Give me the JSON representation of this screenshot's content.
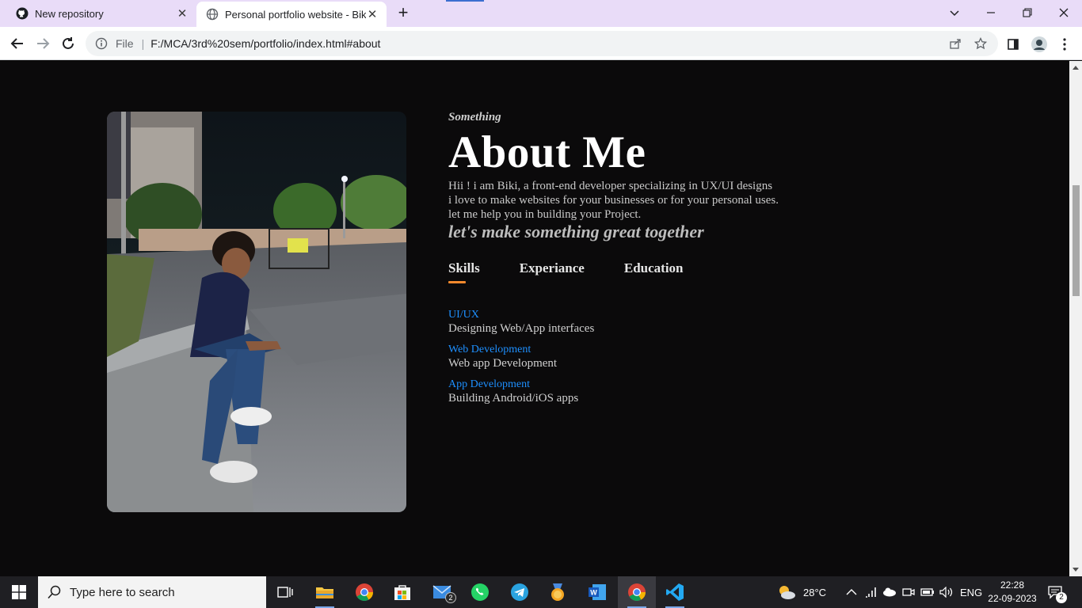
{
  "browser": {
    "tabs": [
      {
        "title": "New repository",
        "icon": "github-icon"
      },
      {
        "title": "Personal portfolio website - Biki",
        "icon": "globe-icon"
      }
    ],
    "address": {
      "scheme_label": "File",
      "url": "F:/MCA/3rd%20sem/portfolio/index.html#about"
    }
  },
  "page": {
    "about": {
      "kicker": "Something",
      "heading": "About Me",
      "intro_lines": [
        "Hii ! i am Biki, a front-end developer specializing in UX/UI designs",
        "i love to make websites for your businesses or for your personal uses.",
        "let me help you in building your Project."
      ],
      "tagline": "let's make something great together"
    },
    "tabs": [
      "Skills",
      "Experiance",
      "Education"
    ],
    "active_tab": "Skills",
    "skills": [
      {
        "title": "UI/UX",
        "desc": "Designing Web/App interfaces"
      },
      {
        "title": "Web Development",
        "desc": "Web app Development"
      },
      {
        "title": "App Development",
        "desc": "Building Android/iOS apps"
      }
    ]
  },
  "taskbar": {
    "search_placeholder": "Type here to search",
    "weather": "28°C",
    "language": "ENG",
    "time": "22:28",
    "date": "22-09-2023",
    "mail_badge": "2",
    "notification_badge": "2"
  },
  "colors": {
    "accent_orange": "#f5892d",
    "skill_blue": "#1e90ff",
    "page_bg": "#0b0a0b"
  }
}
